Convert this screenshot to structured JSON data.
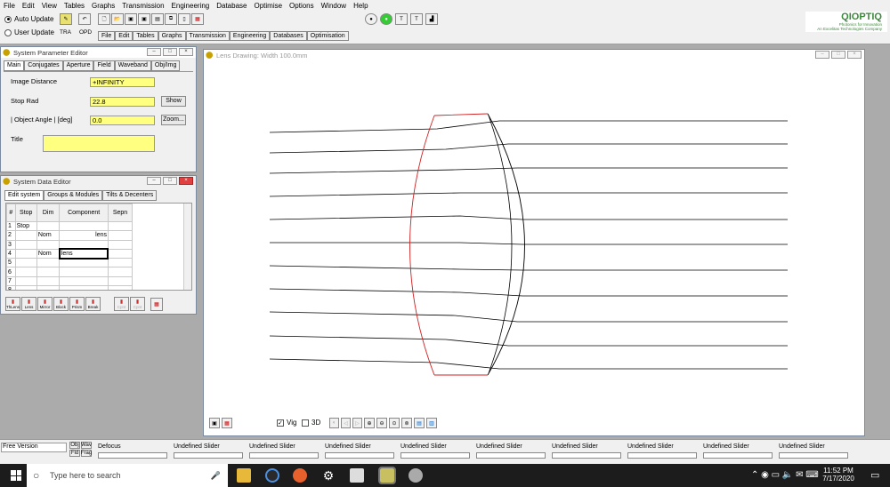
{
  "menu": [
    "File",
    "Edit",
    "View",
    "Tables",
    "Graphs",
    "Transmission",
    "Engineering",
    "Database",
    "Optimise",
    "Options",
    "Window",
    "Help"
  ],
  "update": {
    "auto": "Auto Update",
    "user": "User Update",
    "tra": "TRA",
    "opd": "OPD"
  },
  "toolbar_tabs": [
    "File",
    "Edit",
    "Tables",
    "Graphs",
    "Transmission",
    "Engineering",
    "Databases",
    "Optimisation"
  ],
  "brand": {
    "name": "QIOPTIQ",
    "line1": "Photonics for Innovation",
    "line2": "An Excelitas Technologies Company"
  },
  "spe": {
    "title": "System Parameter Editor",
    "tabs": [
      "Main",
      "Conjugates",
      "Aperture",
      "Field",
      "Waveband",
      "Obj/Img"
    ],
    "image_distance_label": "Image Distance",
    "image_distance": "+INFINITY",
    "stop_rad_label": "Stop Rad",
    "stop_rad": "22.8",
    "show": "Show",
    "obj_angle_label": "| Object Angle |  [deg]",
    "obj_angle": "0.0",
    "zoom": "Zoom...",
    "title_label": "Title",
    "title_value": ""
  },
  "sde": {
    "title": "System Data Editor",
    "tabs": [
      "Edit system",
      "Groups & Modules",
      "Tilts & Decenters"
    ],
    "headers": [
      "#",
      "Stop",
      "Dim",
      "Component",
      "Sepn"
    ],
    "rows": [
      [
        "1",
        "Stop",
        "",
        "",
        ""
      ],
      [
        "2",
        "",
        "Nom",
        "lens",
        ""
      ],
      [
        "3",
        "",
        "",
        "",
        ""
      ],
      [
        "4",
        "",
        "Nom",
        "lens",
        ""
      ],
      [
        "5",
        "",
        "",
        "",
        ""
      ],
      [
        "6",
        "",
        "",
        "",
        ""
      ],
      [
        "7",
        "",
        "",
        "",
        ""
      ],
      [
        "8",
        "",
        "",
        "",
        ""
      ]
    ],
    "buttons": [
      "ThLens",
      "Lens",
      "Mirror",
      "Block",
      "Prism",
      "Break",
      "Cpnt",
      "Cpnt"
    ]
  },
  "drawing": {
    "title": "Lens Drawing: Width  100.0mm",
    "vig": "Vig",
    "threed": "3D"
  },
  "status": {
    "free": "Free Version",
    "obj": "Obj",
    "wav": "Wav",
    "fld": "Fld",
    "fra": "Frag",
    "defocus": "Defocus",
    "slider": "Undefined Slider"
  },
  "taskbar": {
    "search": "Type here to search",
    "time": "11:52 PM",
    "date": "7/17/2020"
  },
  "colors": {
    "field": "#ffff80",
    "lens_front": "#d02020",
    "accent": "#0a64c8"
  }
}
